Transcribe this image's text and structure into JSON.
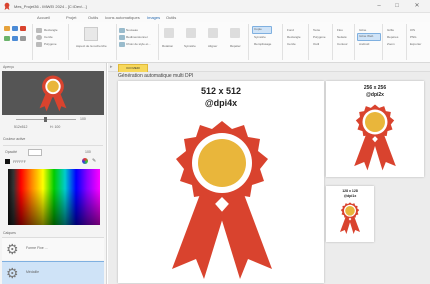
{
  "window": {
    "title": "Mes_Projet36 - IMWEI 2024 - [C:\\Dev\\...]",
    "minimize": "–",
    "maximize": "□",
    "close": "✕"
  },
  "menu": {
    "tabs": [
      "Accueil",
      "Projet",
      "Outils",
      "Icons automatiques",
      "Images",
      "Outils"
    ],
    "active_index": 4
  },
  "ribbon": {
    "g1": [
      "Rectangle",
      "Cercle",
      "Polygone"
    ],
    "g2_label": "Aspect de la recherche",
    "g3": [
      "Nouveau",
      "Redimensionner",
      "Choix de style et..."
    ],
    "g4": [
      "Rotation",
      "Symétrie",
      "Aligner",
      "Répéter"
    ],
    "g5": [
      "Copie",
      "Symétrie",
      "Remplissage"
    ],
    "g6": [
      "Fond",
      "Rectangle",
      "Cercle"
    ],
    "g7": [
      "Texte",
      "Polygone",
      "Outil"
    ],
    "g8": [
      "Flou",
      "Netteté",
      "Contour"
    ],
    "g9": [
      "Icône",
      "Icône Web",
      "Android"
    ],
    "g10": [
      "Grille",
      "Repères",
      "Zoom"
    ],
    "g11": [
      "iOS",
      "PNG",
      "Exporter"
    ],
    "g12": [
      "ICO",
      "SVG",
      "DPI"
    ],
    "selected_label": "Icône Web"
  },
  "leftpanel": {
    "header": "Aperçu",
    "zoom_val": "100",
    "w_label": "512x512",
    "h_label": "H: 100",
    "color_header": "Couleur active",
    "hex_field": "FFFFFF",
    "opacity_label": "Opacité",
    "opacity_val": "100",
    "layers_header": "Calques",
    "layer1": "Forme Fixe ...",
    "layer2": "Médaille"
  },
  "doc": {
    "tab_label": "ICO:MEDI",
    "title": "Génération automatique multi DPI"
  },
  "cards": [
    {
      "size": "512 x 512",
      "dpi": "@dpi4x"
    },
    {
      "size": "256 x 256",
      "dpi": "@dpi2x"
    },
    {
      "size": "128 x 128",
      "dpi": "@dpi1x"
    }
  ],
  "colors": {
    "medal_red": "#d9432e",
    "medal_dark": "#b23522",
    "medal_gold": "#e9b63b",
    "accent": "#2b6cb0"
  }
}
